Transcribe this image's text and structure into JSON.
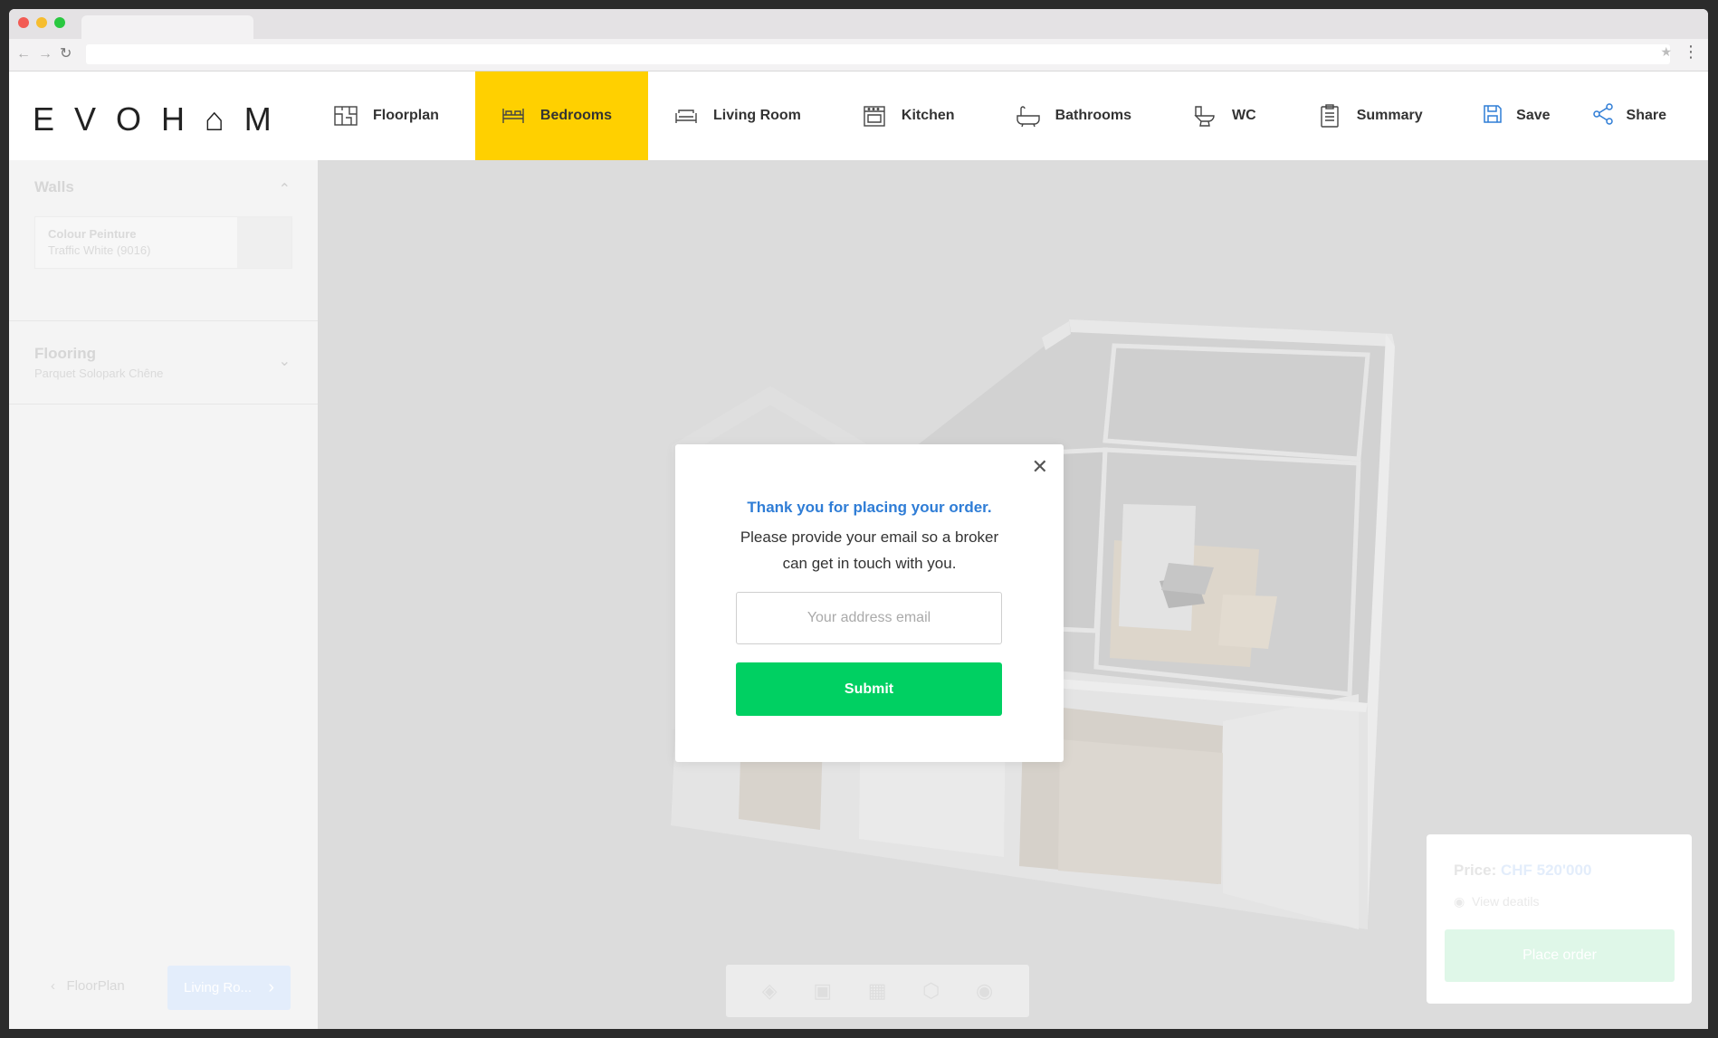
{
  "app": {
    "logo_text": "EVOH⌂M"
  },
  "nav": {
    "items": [
      {
        "label": "Floorplan",
        "icon": "floorplan-icon"
      },
      {
        "label": "Bedrooms",
        "icon": "bed-icon"
      },
      {
        "label": "Living Room",
        "icon": "sofa-icon"
      },
      {
        "label": "Kitchen",
        "icon": "stove-icon"
      },
      {
        "label": "Bathrooms",
        "icon": "bathtub-icon"
      },
      {
        "label": "WC",
        "icon": "toilet-icon"
      },
      {
        "label": "Summary",
        "icon": "clipboard-icon"
      }
    ],
    "active": "Bedrooms"
  },
  "header_actions": {
    "save_label": "Save",
    "share_label": "Share"
  },
  "sidebar": {
    "walls": {
      "title": "Walls",
      "swatch_label": "Colour Peinture",
      "swatch_value": "Traffic White (9016)"
    },
    "flooring": {
      "title": "Flooring",
      "value": "Parquet Solopark Chêne"
    },
    "footer": {
      "prev_label": "FloorPlan",
      "next_label": "Living Ro..."
    }
  },
  "price_card": {
    "price_label": "Price:",
    "price_value": "CHF 520'000",
    "details_label": "View deatils",
    "order_label": "Place order"
  },
  "modal": {
    "title": "Thank you for placing your order.",
    "message": "Please provide your email so a broker can get in touch with you.",
    "email_placeholder": "Your address email",
    "submit_label": "Submit"
  },
  "colors": {
    "accent_yellow": "#ffd000",
    "submit_green": "#00d062",
    "title_blue": "#2f7dd6"
  }
}
